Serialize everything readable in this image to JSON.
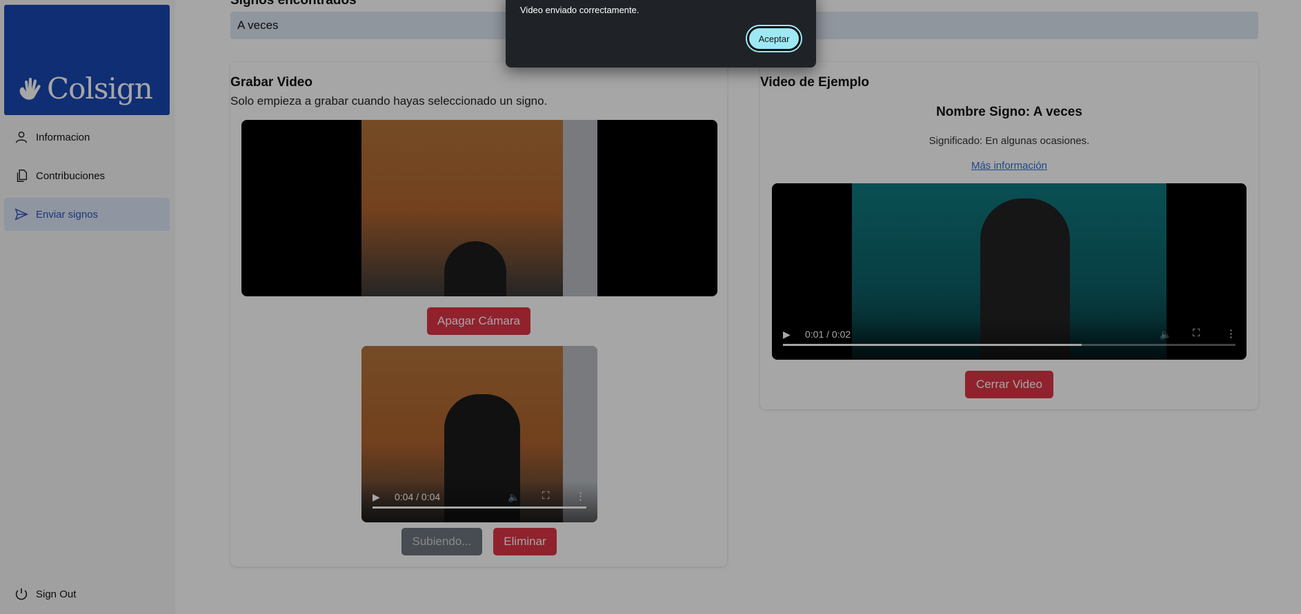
{
  "app": {
    "logo_text": "Colsign"
  },
  "sidebar": {
    "items": [
      {
        "label": "Informacion",
        "icon": "user-icon"
      },
      {
        "label": "Contribuciones",
        "icon": "documents-icon"
      },
      {
        "label": "Enviar signos",
        "icon": "send-icon",
        "active": true
      }
    ],
    "sign_out_label": "Sign Out"
  },
  "found": {
    "title": "Signos encontrados",
    "value": "A veces"
  },
  "record": {
    "title": "Grabar Video",
    "subtitle": "Solo empieza a grabar cuando hayas seleccionado un signo.",
    "camera_button": "Apagar Cámara",
    "recorded_time": "0:04 / 0:04",
    "recorded_progress": 1.0,
    "uploading_button": "Subiendo...",
    "delete_button": "Eliminar"
  },
  "example": {
    "title": "Video de Ejemplo",
    "sign_name": "Nombre Signo: A veces",
    "meaning": "Significado: En algunas ocasiones.",
    "more_info": "Más información",
    "time": "0:01 / 0:02",
    "progress": 0.66,
    "close_button": "Cerrar Video"
  },
  "dialog": {
    "message": "Video enviado correctamente.",
    "accept_button": "Aceptar"
  },
  "colors": {
    "brand_blue": "#1747b3",
    "danger_red": "#dc3545",
    "accent_cyan": "#9ee8f5"
  }
}
